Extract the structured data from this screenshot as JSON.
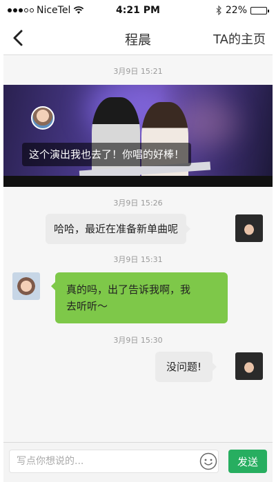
{
  "status_bar": {
    "carrier": "NiceTel",
    "time": "4:21 PM",
    "battery": "22%",
    "battery_level": 0.22,
    "icons": [
      "signal-dots-icon",
      "wifi-icon",
      "bluetooth-icon",
      "battery-icon"
    ]
  },
  "nav": {
    "title": "程晨",
    "right_label": "TA的主页",
    "back_icon": "back-chevron-icon"
  },
  "messages": [
    {
      "timestamp": "3月9日 15:21",
      "type": "image-comment",
      "text": "这个演出我也去了！你唱的好棒！"
    },
    {
      "timestamp": "3月9日 15:26",
      "type": "outgoing",
      "text": "哈哈，最近在准备新单曲呢"
    },
    {
      "timestamp": "3月9日 15:31",
      "type": "incoming",
      "lines": [
        "真的吗，出了告诉我啊，我",
        "去听听～"
      ]
    },
    {
      "timestamp": "3月9日 15:30",
      "type": "outgoing",
      "text": "没问题!"
    }
  ],
  "input_bar": {
    "placeholder": "写点你想说的...",
    "value": "",
    "emoji_icon": "smiley-icon",
    "send_label": "发送"
  },
  "colors": {
    "send": "#27ae60",
    "incoming_bubble": "#7ec849",
    "outgoing_bubble": "#ebebeb",
    "background": "#f6f6f6"
  }
}
